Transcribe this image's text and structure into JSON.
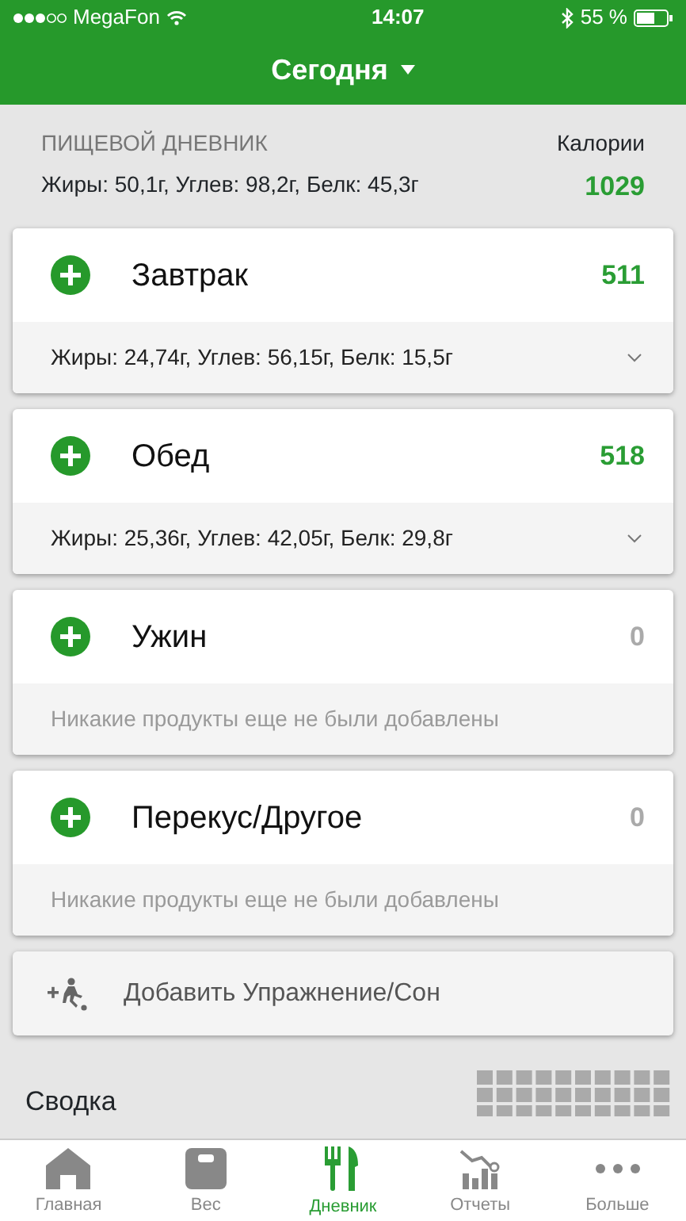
{
  "status_bar": {
    "carrier": "MegaFon",
    "time": "14:07",
    "battery": "55 %"
  },
  "header": {
    "title": "Сегодня"
  },
  "summary": {
    "heading": "ПИЩЕВОЙ ДНЕВНИК",
    "macros": "Жиры: 50,1г, Углев: 98,2г, Белк: 45,3г",
    "calories_label": "Калории",
    "calories": "1029"
  },
  "meals": [
    {
      "name": "Завтрак",
      "calories": "511",
      "kind": "logged",
      "detail": "Жиры: 24,74г, Углев: 56,15г, Белк: 15,5г"
    },
    {
      "name": "Обед",
      "calories": "518",
      "kind": "logged",
      "detail": "Жиры: 25,36г, Углев: 42,05г, Белк: 29,8г"
    },
    {
      "name": "Ужин",
      "calories": "0",
      "kind": "empty",
      "detail": "Никакие продукты еще не были добавлены"
    },
    {
      "name": "Перекус/Другое",
      "calories": "0",
      "kind": "empty",
      "detail": "Никакие продукты еще не были добавлены"
    }
  ],
  "exercise": {
    "label": "Добавить Упражнение/Сон"
  },
  "section": {
    "title": "Сводка"
  },
  "tabs": [
    {
      "label": "Главная",
      "kind": "home",
      "selected": false
    },
    {
      "label": "Вес",
      "kind": "scale",
      "selected": false
    },
    {
      "label": "Дневник",
      "kind": "diary",
      "selected": true
    },
    {
      "label": "Отчеты",
      "kind": "reports",
      "selected": false
    },
    {
      "label": "Больше",
      "kind": "more",
      "selected": false
    }
  ]
}
